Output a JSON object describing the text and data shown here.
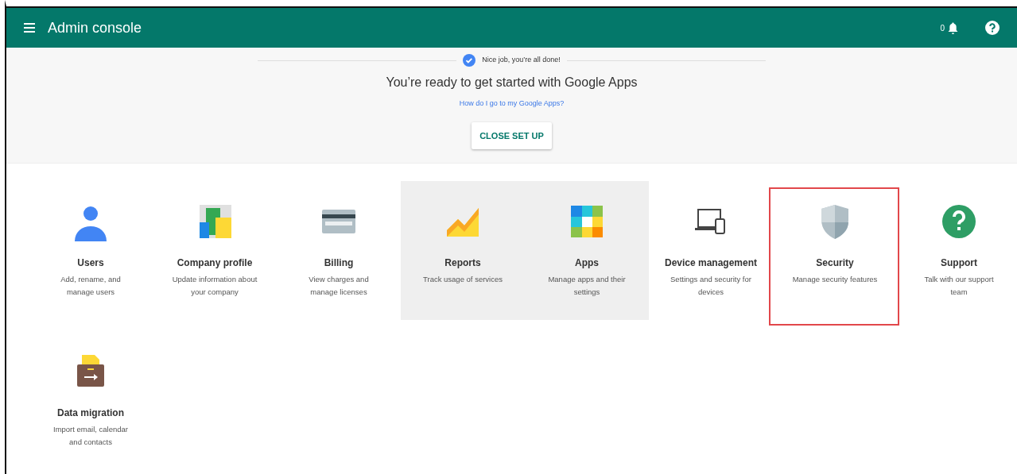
{
  "header": {
    "title": "Admin console",
    "notification_count": "0"
  },
  "setup": {
    "status": "Nice job, you’re all done!",
    "heading": "You’re ready to get started with Google Apps",
    "link": "How do I go to my Google Apps?",
    "button": "CLOSE SET UP"
  },
  "tiles": [
    {
      "kind": "users",
      "title": "Users",
      "description": "Add, rename, and manage users",
      "highlighted": false,
      "outlined": false
    },
    {
      "kind": "company",
      "title": "Company profile",
      "description": "Update information about your company",
      "highlighted": false,
      "outlined": false
    },
    {
      "kind": "billing",
      "title": "Billing",
      "description": "View charges and manage licenses",
      "highlighted": false,
      "outlined": false
    },
    {
      "kind": "reports",
      "title": "Reports",
      "description": "Track usage of services",
      "highlighted": true,
      "outlined": false
    },
    {
      "kind": "apps",
      "title": "Apps",
      "description": "Manage apps and their settings",
      "highlighted": true,
      "outlined": false
    },
    {
      "kind": "devices",
      "title": "Device management",
      "description": "Settings and security for devices",
      "highlighted": false,
      "outlined": false
    },
    {
      "kind": "security",
      "title": "Security",
      "description": "Manage security features",
      "highlighted": false,
      "outlined": true
    },
    {
      "kind": "support",
      "title": "Support",
      "description": "Talk with our support team",
      "highlighted": false,
      "outlined": false
    },
    {
      "kind": "migration",
      "title": "Data migration",
      "description": "Import email, calendar and contacts",
      "highlighted": false,
      "outlined": false
    }
  ]
}
